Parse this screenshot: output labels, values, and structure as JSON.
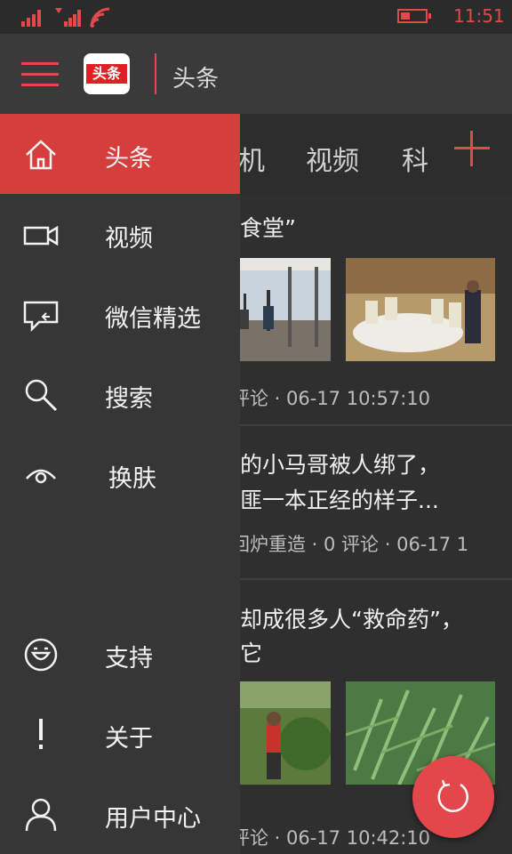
{
  "status_bar": {
    "time": "11:51",
    "battery_level": 0.4,
    "accent_color": "#e04a4a"
  },
  "header": {
    "logo_text": "头条",
    "title": "头条"
  },
  "tabs": [
    {
      "label": "机"
    },
    {
      "label": "视频"
    },
    {
      "label": "科"
    }
  ],
  "drawer": {
    "items": [
      {
        "label": "头条",
        "icon": "home-icon",
        "active": true
      },
      {
        "label": "视频",
        "icon": "video-camera-icon"
      },
      {
        "label": "微信精选",
        "icon": "chat-bubble-icon"
      },
      {
        "label": "搜索",
        "icon": "search-icon"
      },
      {
        "label": "换肤",
        "icon": "eye-icon"
      },
      {
        "label": "支持",
        "icon": "smile-icon"
      },
      {
        "label": "关于",
        "icon": "exclamation-icon"
      },
      {
        "label": "用户中心",
        "icon": "user-icon"
      }
    ]
  },
  "articles": [
    {
      "title_lines": [
        "食堂”"
      ],
      "meta": "评论 · 06-17 10:57:10"
    },
    {
      "title_lines": [
        "的小马哥被人绑了，",
        "匪一本正经的样子..."
      ],
      "meta": "回炉重造 · 0 评论 · 06-17 1"
    },
    {
      "title_lines": [
        "却成很多人“救命药”，",
        "它"
      ],
      "meta": "评论 · 06-17 10:42:10"
    }
  ],
  "colors": {
    "accent": "#e04a4a",
    "drawer_bg": "#363636",
    "active_item": "#d63d3d",
    "fab": "#e3474c"
  }
}
